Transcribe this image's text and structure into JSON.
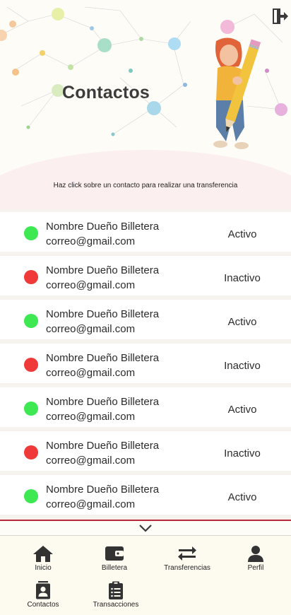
{
  "header": {
    "title": "Contactos",
    "subtitle": "Haz click sobre un contacto para realizar una transferencia"
  },
  "icons": {
    "logout": "logout-icon",
    "chevron": "chevron-down-icon"
  },
  "colors": {
    "active": "#3ee852",
    "inactive": "#f03a3a",
    "accent_line": "#b6283a"
  },
  "contacts": [
    {
      "name": "Nombre Dueño Billetera",
      "email": "correo@gmail.com",
      "status": "Activo"
    },
    {
      "name": "Nombre Dueño Billetera",
      "email": "correo@gmail.com",
      "status": "Inactivo"
    },
    {
      "name": "Nombre Dueño Billetera",
      "email": "correo@gmail.com",
      "status": "Activo"
    },
    {
      "name": "Nombre Dueño Billetera",
      "email": "correo@gmail.com",
      "status": "Inactivo"
    },
    {
      "name": "Nombre Dueño Billetera",
      "email": "correo@gmail.com",
      "status": "Activo"
    },
    {
      "name": "Nombre Dueño Billetera",
      "email": "correo@gmail.com",
      "status": "Inactivo"
    },
    {
      "name": "Nombre Dueño Billetera",
      "email": "correo@gmail.com",
      "status": "Activo"
    }
  ],
  "nav": {
    "items": [
      {
        "label": "Inicio",
        "icon": "home-icon"
      },
      {
        "label": "Billetera",
        "icon": "wallet-icon"
      },
      {
        "label": "Transferencias",
        "icon": "transfer-icon"
      },
      {
        "label": "Perfil",
        "icon": "user-icon"
      },
      {
        "label": "Contactos",
        "icon": "contacts-icon"
      },
      {
        "label": "Transacciones",
        "icon": "clipboard-icon"
      }
    ]
  }
}
